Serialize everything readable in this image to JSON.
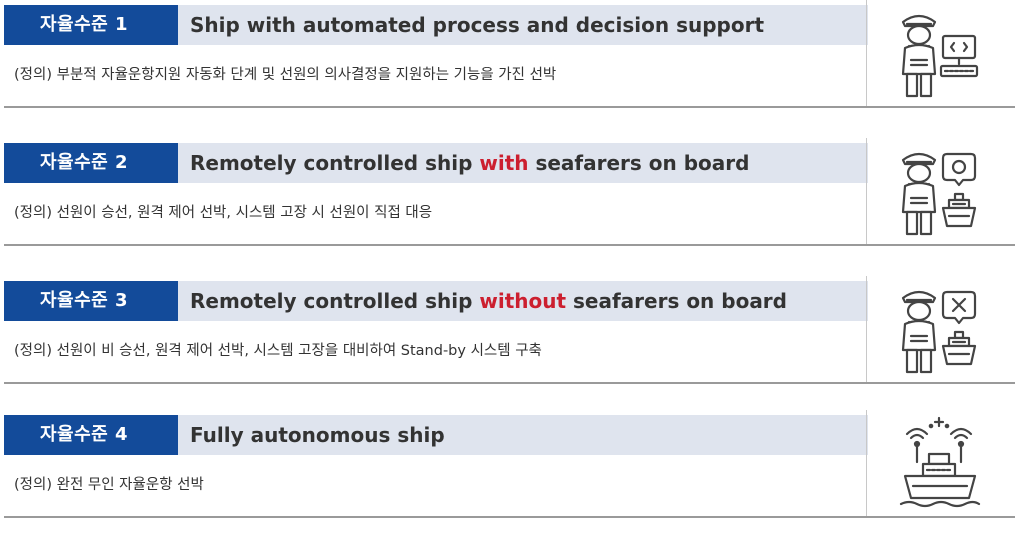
{
  "levels": [
    {
      "badge": "자율수준 1",
      "title_before": "Ship with automated process and decision support",
      "title_emphasis": "",
      "title_after": "",
      "definition": "(정의) 부분적 자율운항지원 자동화 단계 및 선원의 의사결정을 지원하는 기능을 가진 선박",
      "icon": "seafarer-computer-icon"
    },
    {
      "badge": "자율수준 2",
      "title_before": "Remotely controlled ship ",
      "title_emphasis": "with",
      "title_after": " seafarers on board",
      "definition": "(정의) 선원이 승선, 원격 제어 선박, 시스템 고장 시 선원이 직접 대응",
      "icon": "seafarer-ship-signal-icon"
    },
    {
      "badge": "자율수준 3",
      "title_before": "Remotely controlled ship ",
      "title_emphasis": "without",
      "title_after": " seafarers on board",
      "definition": "(정의) 선원이 비 승선, 원격 제어 선박, 시스템 고장을 대비하여 Stand-by 시스템 구축",
      "icon": "seafarer-ship-no-signal-icon"
    },
    {
      "badge": "자율수준 4",
      "title_before": "Fully autonomous ship",
      "title_emphasis": "",
      "title_after": "",
      "definition": "(정의) 완전 무인 자율운항 선박",
      "icon": "autonomous-ship-icon"
    }
  ],
  "colors": {
    "badge_background": "#134b9a",
    "title_background": "#dfe4ee",
    "emphasis": "#cc1f2f",
    "icon_stroke": "#444444"
  }
}
